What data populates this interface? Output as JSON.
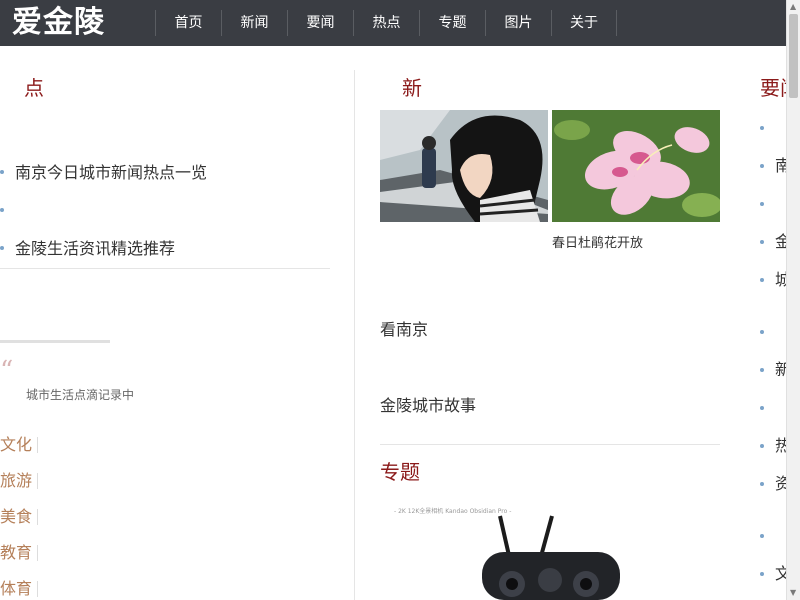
{
  "header": {
    "logo": "爱金陵",
    "nav": [
      "首页",
      "新闻",
      "要闻",
      "热点",
      "专题",
      "图片",
      "关于"
    ]
  },
  "left": {
    "title": "点",
    "bullets": [
      "南京今日城市新闻热点一览",
      "",
      "金陵生活资讯精选推荐"
    ],
    "quote_mark": "“",
    "quote_text": "城市生活点滴记录中",
    "categories": [
      "文化",
      "旅游",
      "美食",
      "教育",
      "体育"
    ]
  },
  "middle": {
    "title": "新",
    "photo_caption": "春日杜鹃花开放",
    "links": [
      "看南京",
      "金陵城市故事"
    ],
    "special_title": "专题",
    "special_caption": "- 2K 12K全景相机 Kandao Obsidian Pro -"
  },
  "right": {
    "title": "要闻",
    "items": [
      "",
      "南京",
      "",
      "金陵",
      "城市",
      "",
      "新闻",
      "",
      "热点",
      "资讯",
      "",
      "文化"
    ]
  },
  "colors": {
    "topbar": "#3a3d43",
    "accent_red": "#8b1a1a",
    "category_brown": "#b5805a",
    "bullet_blue": "#7ba3c9"
  }
}
